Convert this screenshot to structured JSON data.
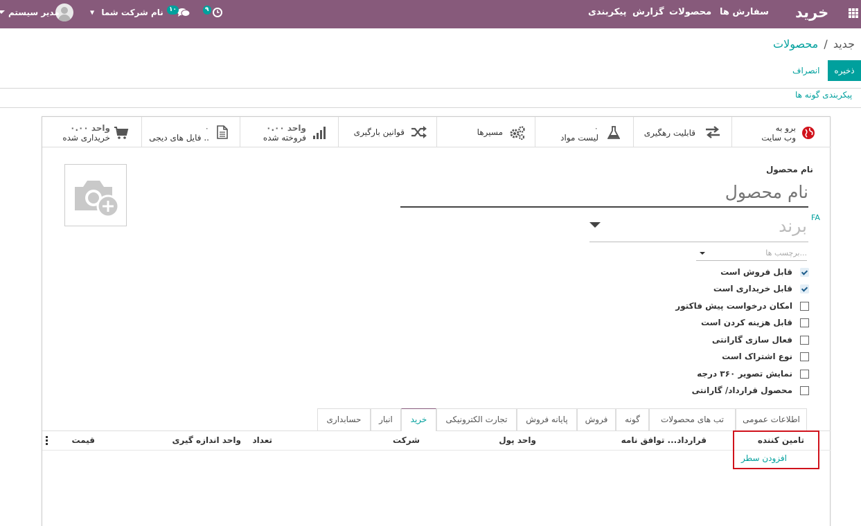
{
  "navbar": {
    "app_name": "خرید",
    "menu": [
      "سفارش ها",
      "محصولات",
      "گزارش",
      "پیکربندی"
    ],
    "activity_count": "۹",
    "message_count": "۱۰",
    "company": "نام شرکت شما",
    "user": "مدیر سیستم",
    "color": "#875a7b"
  },
  "breadcrumb": {
    "parent": "محصولات",
    "separator": "/",
    "current": "جدید"
  },
  "buttons": {
    "save": "ذخیره",
    "discard": "انصراف"
  },
  "config_link": "پیکربندی گونه ها",
  "smart_buttons": [
    {
      "line1": "برو به",
      "line2": "وب سایت",
      "icon": "globe-icon"
    },
    {
      "line1": "قابلیت رهگیری",
      "line2": "",
      "icon": "exchange-icon"
    },
    {
      "line1": "۰",
      "line2": "لیست مواد",
      "icon": "flask-icon"
    },
    {
      "line1": "مسیرها",
      "line2": "",
      "icon": "cogs-icon"
    },
    {
      "line1": "قوانین بارگیری",
      "line2": "",
      "icon": "random-icon"
    },
    {
      "line1": "۰.۰۰ واحد",
      "line2": "فروخته شده",
      "icon": "bar-chart-icon"
    },
    {
      "line1": "۰",
      "line2": "فایل های دیجی ..",
      "icon": "file-icon"
    },
    {
      "line1": "۰.۰۰ واحد",
      "line2": "خریداری شده",
      "icon": "shopping-cart-icon"
    }
  ],
  "form": {
    "name_label": "نام محصول",
    "name_placeholder": "نام محصول",
    "lang": "FA",
    "brand_placeholder": "برند",
    "tags_placeholder": "برچسب ها..."
  },
  "checkboxes": [
    {
      "label": "قابل فروش است",
      "checked": true
    },
    {
      "label": "قابل خریداری است",
      "checked": true
    },
    {
      "label": "امکان درخواست پیش فاکتور",
      "checked": false
    },
    {
      "label": "قابل هزینه کردن است",
      "checked": false
    },
    {
      "label": "فعال سازی گارانتی",
      "checked": false
    },
    {
      "label": "نوع اشتراک است",
      "checked": false
    },
    {
      "label": "نمایش تصویر ۳۶۰ درجه",
      "checked": false
    },
    {
      "label": "محصول قرارداد/ گارانتی",
      "checked": false
    }
  ],
  "tabs": [
    "اطلاعات عمومی",
    "تب های محصولات",
    "گونه",
    "فروش",
    "پایانه فروش",
    "تجارت الکترونیکی",
    "خرید",
    "انبار",
    "حسابداری"
  ],
  "active_tab": "خرید",
  "table": {
    "columns": [
      "تامین کننده",
      "قرارداد... توافق نامه",
      "واحد پول",
      "شرکت",
      "تعداد",
      "واحد اندازه گیری",
      "قیمت"
    ],
    "add_line": "افزودن سطر"
  },
  "colors": {
    "primary": "#875a7b",
    "accent": "#00a09d",
    "highlight": "#d0121b"
  }
}
